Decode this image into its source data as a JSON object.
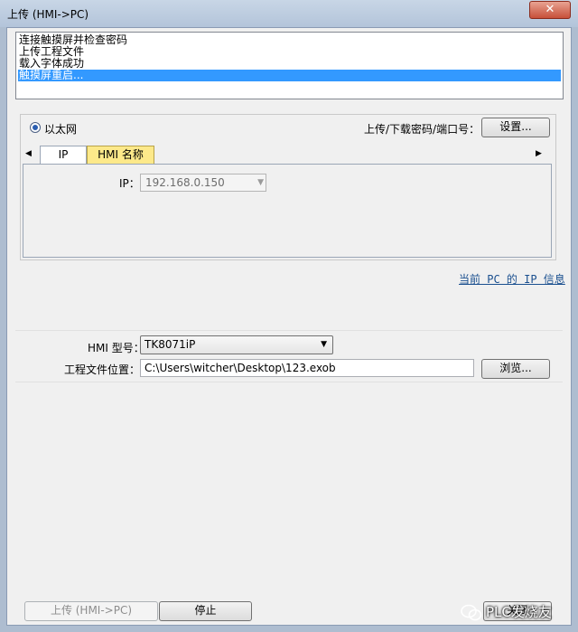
{
  "window": {
    "title": "上传 (HMI->PC)",
    "close_glyph": "✕"
  },
  "log": {
    "lines": [
      "连接触摸屏并检查密码",
      "上传工程文件",
      "载入字体成功",
      "触摸屏重启..."
    ],
    "selected_index": 3
  },
  "connection": {
    "ethernet_label": "以太网",
    "upload_password_label": "上传/下载密码/端口号：",
    "settings_button": "设置...",
    "tabs": [
      {
        "label": "IP"
      },
      {
        "label": "HMI 名称"
      }
    ],
    "ip_label": "IP：",
    "ip_value": "192.168.0.150",
    "current_pc_ip_link": "当前 PC 的 IP 信息"
  },
  "project": {
    "model_label": "HMI 型号：",
    "model_value": "TK8071iP",
    "path_label": "工程文件位置：",
    "path_value": "C:\\Users\\witcher\\Desktop\\123.exob",
    "browse_button": "浏览..."
  },
  "footer": {
    "upload_button": "上传 (HMI->PC)",
    "stop_button": "停止",
    "close_button": "关闭"
  },
  "watermark": {
    "text": "PLC发烧友"
  },
  "colors": {
    "selection": "#3399ff",
    "hmi_tab": "#fde98a",
    "link": "#1a4f8f"
  }
}
